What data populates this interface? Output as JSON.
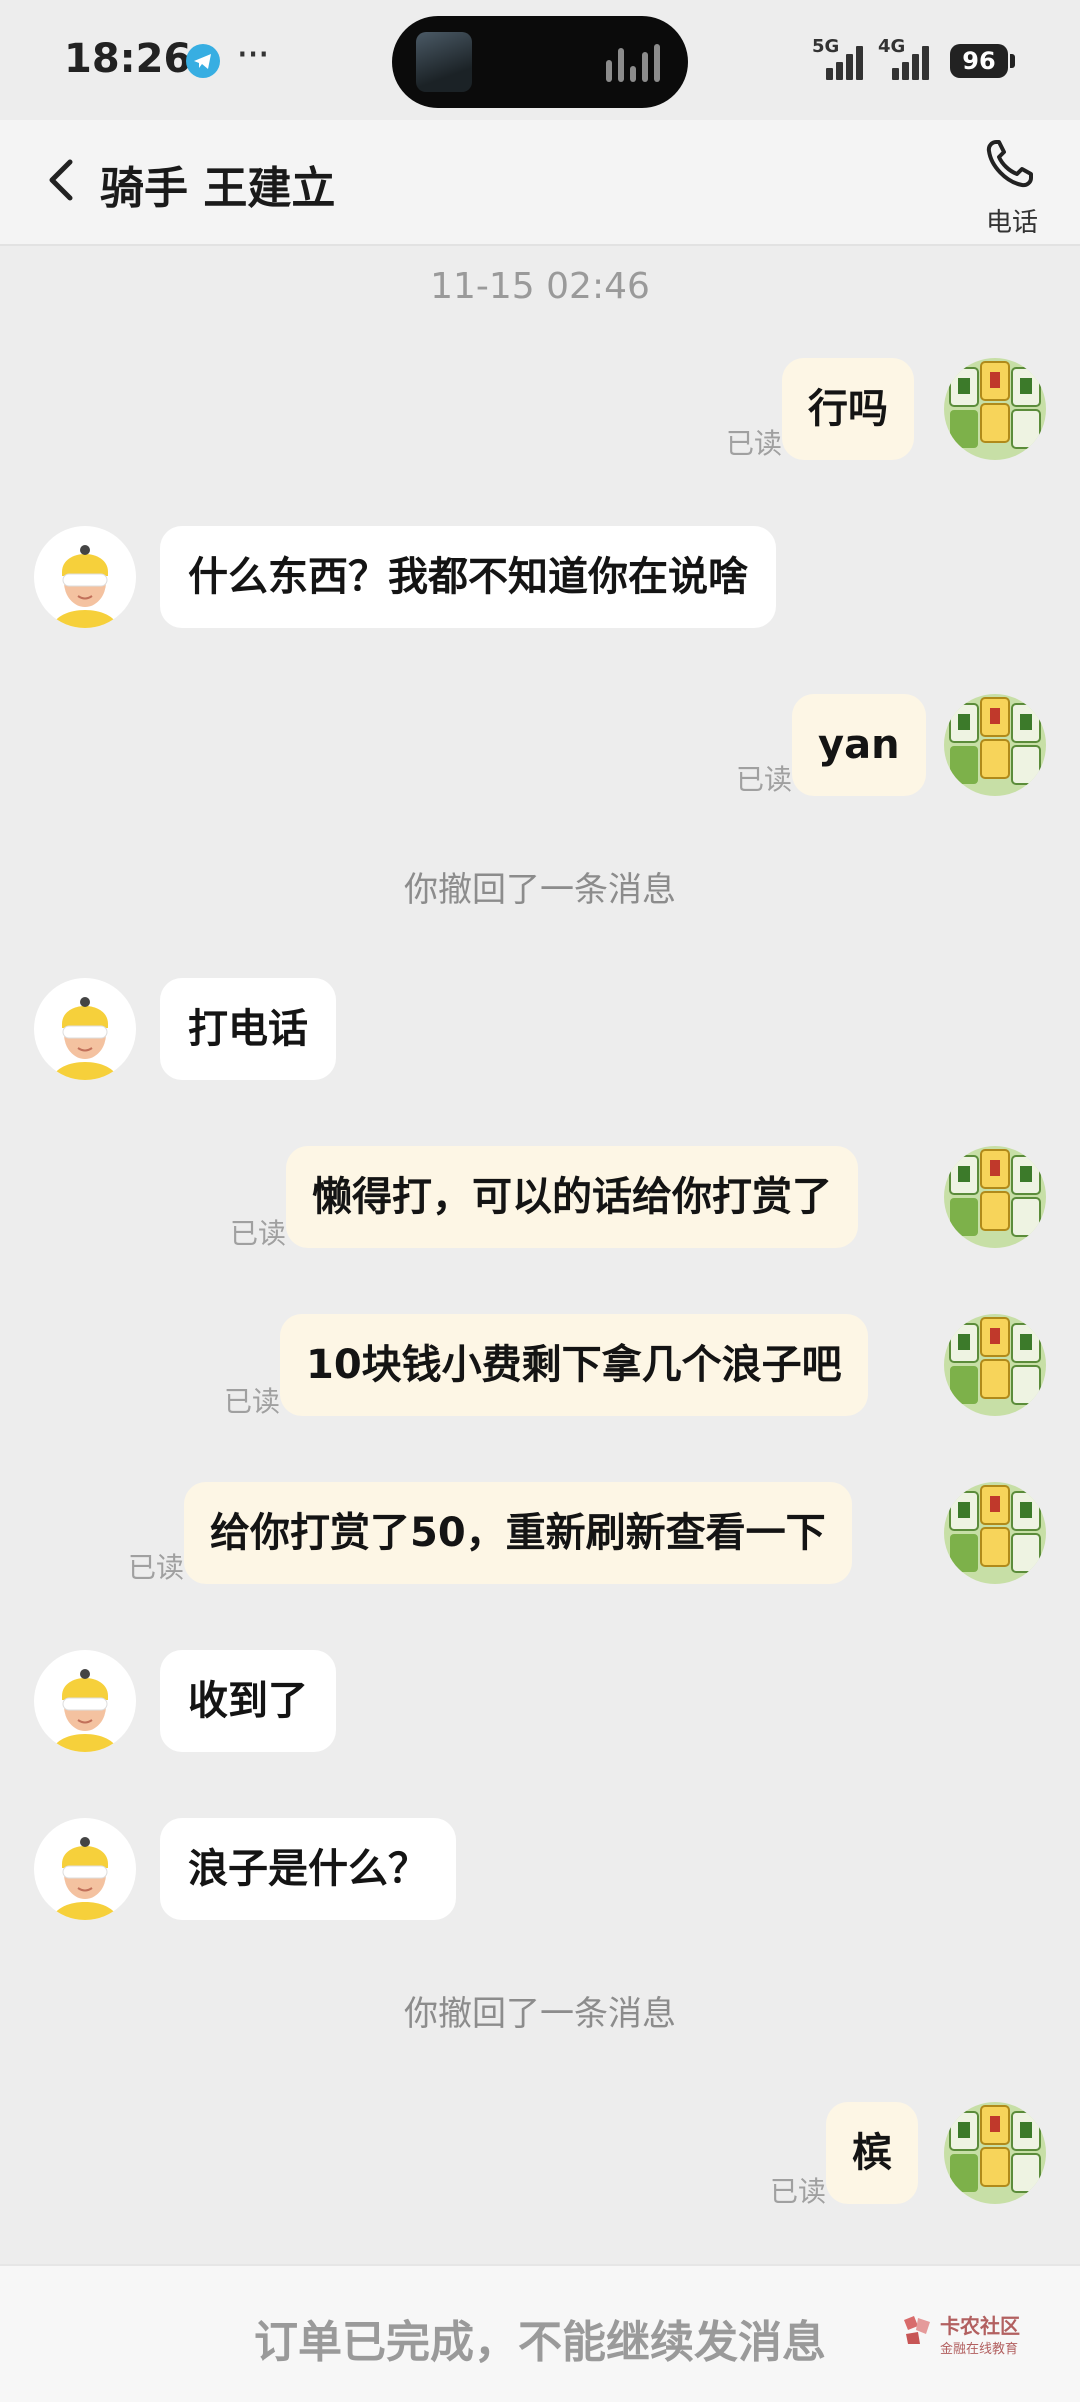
{
  "status_bar": {
    "time": "18:26",
    "signal_1": "5G",
    "signal_2": "4G",
    "battery": "96"
  },
  "header": {
    "title": "骑手 王建立",
    "call_label": "电话"
  },
  "timestamp": "11-15 02:46",
  "read_label": "已读",
  "messages": [
    {
      "from": "me",
      "text": "行吗",
      "read": "已读"
    },
    {
      "from": "rider",
      "text": "什么东西？我都不知道你在说啥"
    },
    {
      "from": "me",
      "text": "yan",
      "read": "已读"
    },
    {
      "from": "system",
      "text": "你撤回了一条消息"
    },
    {
      "from": "rider",
      "text": "打电话"
    },
    {
      "from": "me",
      "text": "懒得打，可以的话给你打赏了",
      "read": "已读"
    },
    {
      "from": "me",
      "text": "10块钱小费剩下拿几个浪子吧",
      "read": "已读"
    },
    {
      "from": "me",
      "text": "给你打赏了50，重新刷新查看一下",
      "read": "已读"
    },
    {
      "from": "rider",
      "text": "收到了"
    },
    {
      "from": "rider",
      "text": "浪子是什么？"
    },
    {
      "from": "system",
      "text": "你撤回了一条消息"
    },
    {
      "from": "me",
      "text": "槟",
      "read": "已读"
    }
  ],
  "footer": {
    "notice": "订单已完成，不能继续发消息"
  },
  "watermark": {
    "title": "卡农社区",
    "subtitle": "金融在线教育"
  },
  "colors": {
    "background": "#ededed",
    "outgoing_bubble": "#fdf6e5",
    "incoming_bubble": "#ffffff",
    "muted_text": "#9a9a9a"
  }
}
